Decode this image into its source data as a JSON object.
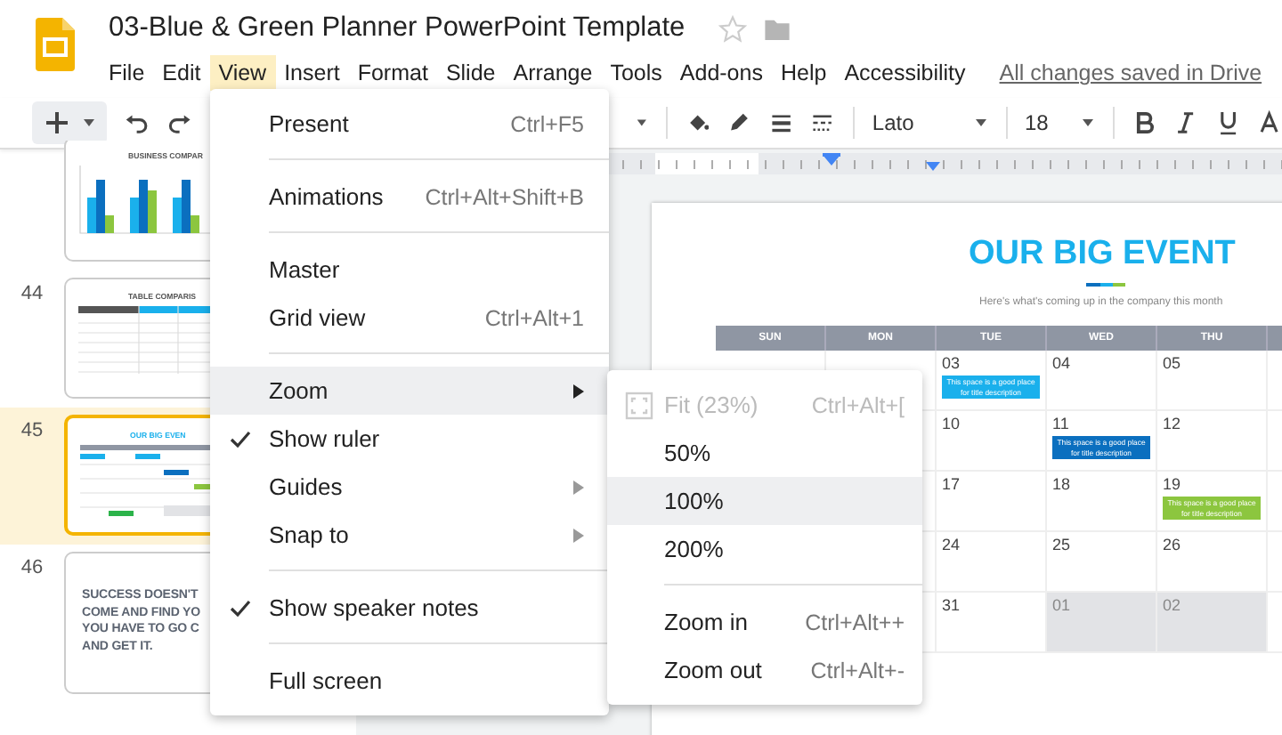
{
  "app": {
    "title": "03-Blue & Green Planner PowerPoint Template",
    "save_status": "All changes saved in Drive",
    "menus": [
      {
        "label": "File",
        "selected": false
      },
      {
        "label": "Edit",
        "selected": false
      },
      {
        "label": "View",
        "selected": true
      },
      {
        "label": "Insert",
        "selected": false
      },
      {
        "label": "Format",
        "selected": false
      },
      {
        "label": "Slide",
        "selected": false
      },
      {
        "label": "Arrange",
        "selected": false
      },
      {
        "label": "Tools",
        "selected": false
      },
      {
        "label": "Add-ons",
        "selected": false
      },
      {
        "label": "Help",
        "selected": false
      },
      {
        "label": "Accessibility",
        "selected": false
      }
    ]
  },
  "toolbar": {
    "font": "Lato",
    "font_size": "18"
  },
  "filmstrip": [
    {
      "kind": "chart",
      "title": "BUSINESS COMPAR",
      "selected": false
    },
    {
      "number": "44",
      "kind": "table",
      "title": "TABLE COMPARIS",
      "selected": false
    },
    {
      "number": "45",
      "kind": "calendar",
      "title": "OUR BIG EVEN",
      "selected": true
    },
    {
      "number": "46",
      "kind": "quote",
      "lines": [
        "SUCCESS DOESN'T",
        "COME AND FIND YO",
        "YOU HAVE TO GO C",
        "AND GET IT."
      ],
      "selected": false
    }
  ],
  "slide": {
    "title": "OUR BIG EVENT",
    "subtitle": "Here's what's coming up in the company this month",
    "columns": [
      "SUN",
      "MON",
      "TUE",
      "WED",
      "THU"
    ],
    "weeks": [
      {
        "days": [
          {
            "date": "03",
            "muted": false,
            "event": {
              "text": "This space is a good place for title description",
              "color": "#1ab0ec"
            }
          },
          {
            "date": "04",
            "muted": false
          },
          {
            "date": "05",
            "muted": false
          }
        ]
      },
      {
        "days": [
          {
            "date": "10",
            "muted": false
          },
          {
            "date": "11",
            "muted": false,
            "event": {
              "text": "This space is a good place for title description",
              "color": "#0b6fbf"
            }
          },
          {
            "date": "12",
            "muted": false
          }
        ]
      },
      {
        "days": [
          {
            "date": "17",
            "muted": false
          },
          {
            "date": "18",
            "muted": false
          },
          {
            "date": "19",
            "muted": false,
            "event": {
              "text": "This space is a good place for title description",
              "color": "#8cc63f"
            }
          }
        ]
      },
      {
        "days": [
          {
            "date": "24",
            "muted": false
          },
          {
            "date": "25",
            "muted": false
          },
          {
            "date": "26",
            "muted": false
          }
        ]
      },
      {
        "days": [
          {
            "date": "31",
            "muted": false
          },
          {
            "date": "01",
            "muted": true
          },
          {
            "date": "02",
            "muted": true
          }
        ]
      }
    ]
  },
  "view_menu": {
    "sections": [
      [
        {
          "label": "Present",
          "shortcut": "Ctrl+F5",
          "checked": false,
          "submenu": false,
          "selected": false
        }
      ],
      [
        {
          "label": "Animations",
          "shortcut": "Ctrl+Alt+Shift+B",
          "checked": false,
          "submenu": false,
          "selected": false
        }
      ],
      [
        {
          "label": "Master",
          "checked": false,
          "submenu": false,
          "selected": false
        },
        {
          "label": "Grid view",
          "shortcut": "Ctrl+Alt+1",
          "checked": false,
          "submenu": false,
          "selected": false
        }
      ],
      [
        {
          "label": "Zoom",
          "checked": false,
          "submenu": true,
          "selected": true
        },
        {
          "label": "Show ruler",
          "checked": true,
          "submenu": false,
          "selected": false
        },
        {
          "label": "Guides",
          "checked": false,
          "submenu": true,
          "selected": false
        },
        {
          "label": "Snap to",
          "checked": false,
          "submenu": true,
          "selected": false
        }
      ],
      [
        {
          "label": "Show speaker notes",
          "checked": true,
          "submenu": false,
          "selected": false
        }
      ],
      [
        {
          "label": "Full screen",
          "checked": false,
          "submenu": false,
          "selected": false
        }
      ]
    ]
  },
  "zoom_menu": {
    "sections": [
      [
        {
          "kind": "fit",
          "label": "Fit (23%)",
          "shortcut": "Ctrl+Alt+[",
          "disabled": true,
          "selected": false
        },
        {
          "kind": "plain",
          "label": "50%",
          "disabled": false,
          "selected": false
        },
        {
          "kind": "plain",
          "label": "100%",
          "disabled": false,
          "selected": true
        },
        {
          "kind": "plain",
          "label": "200%",
          "disabled": false,
          "selected": false
        }
      ],
      [
        {
          "kind": "plain",
          "label": "Zoom in",
          "shortcut": "Ctrl+Alt++",
          "disabled": false,
          "selected": false
        },
        {
          "kind": "plain",
          "label": "Zoom out",
          "shortcut": "Ctrl+Alt+-",
          "disabled": false,
          "selected": false
        }
      ]
    ]
  }
}
